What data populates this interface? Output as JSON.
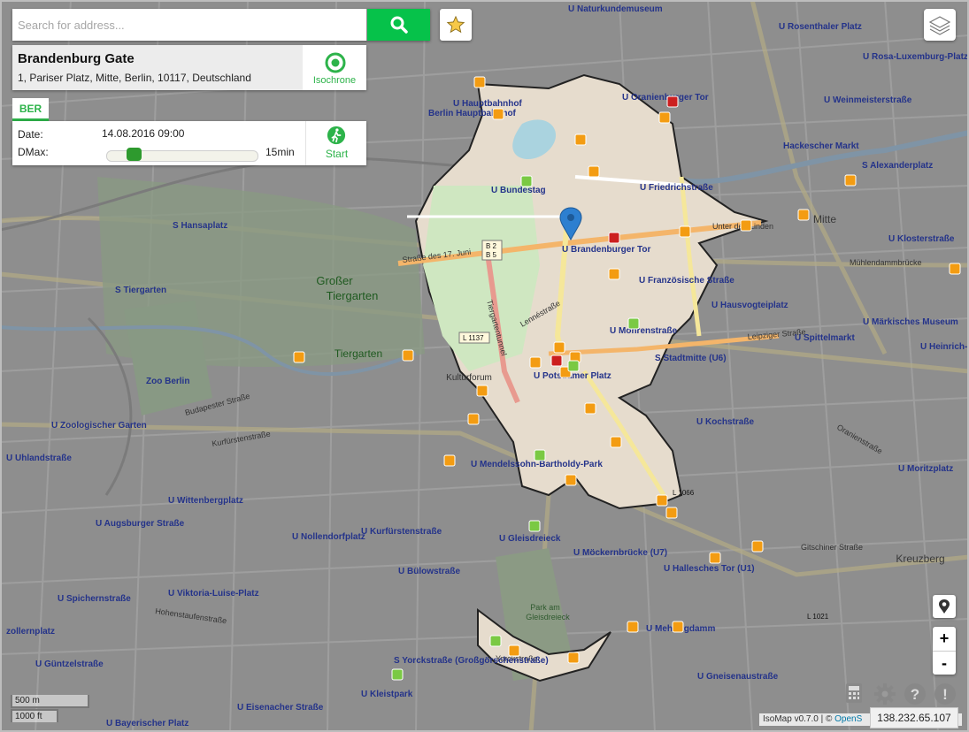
{
  "search": {
    "placeholder": "Search for address..."
  },
  "location": {
    "name": "Brandenburg Gate",
    "address": "1, Pariser Platz, Mitte, Berlin, 10117, Deutschland",
    "isochrone_label": "Isochrone"
  },
  "tab": {
    "label": "BER"
  },
  "form": {
    "date_label": "Date:",
    "date_value": "14.08.2016 09:00",
    "dmax_label": "DMax:",
    "dmax_value": "15min",
    "start_label": "Start"
  },
  "scale": {
    "metric": "500 m",
    "imperial": "1000 ft"
  },
  "attribution": {
    "version": "IsoMap v0.7.0 | ©",
    "osm": "OpenS"
  },
  "ip": "138.232.65.107",
  "colors": {
    "accent": "#2db34a",
    "search_button": "#06c24a",
    "marker": "#2d7fd0"
  },
  "icons": {
    "search": "search-icon",
    "favorite": "star-icon",
    "layers": "layers-icon",
    "isochrone": "target-icon",
    "start": "walker-icon",
    "pin": "location-pin-icon",
    "calculator": "calculator-icon",
    "settings": "gear-icon",
    "help": "question-icon",
    "info": "exclamation-icon"
  },
  "map_labels": {
    "stations": [
      "U Naturkundemuseum",
      "U Rosenthaler Platz",
      "U Rosa-Luxemburg-Platz",
      "U Oranienburger Tor",
      "U Weinmeisterstraße",
      "U Hauptbahnhof",
      "Berlin Hauptbahnhof",
      "Hackescher Markt",
      "S Alexanderplatz",
      "U Bundestag",
      "U Friedrichstraße",
      "S Hansaplatz",
      "U Brandenburger Tor",
      "U Klosterstraße",
      "U Französische Straße",
      "U Hausvogteiplatz",
      "S Tiergarten",
      "U Mohrenstraße",
      "U Märkisches Museum",
      "U Spittelmarkt",
      "S Stadtmitte (U6)",
      "U Potsdamer Platz",
      "U Kochstraße",
      "Zoo Berlin",
      "U Zoologischer Garten",
      "U Mendelssohn-Bartholdy-Park",
      "U Moritzplatz",
      "U Uhlandstraße",
      "U Wittenbergplatz",
      "U Augsburger Straße",
      "U Nollendorfplatz",
      "U Kurfürstenstraße",
      "U Gleisdreieck",
      "U Möckernbrücke (U7)",
      "U Hallesches Tor (U1)",
      "U Bülowstraße",
      "U Viktoria-Luise-Platz",
      "U Spichernstraße",
      "U Mehringdamm",
      "U Güntzelstraße",
      "U Kleistpark",
      "U Eisenacher Straße",
      "U Gneisenaustraße",
      "U Bayerischer Platz",
      "S Yorckstraße (Großgörschenstraße)",
      "U Heinrich-"
    ],
    "areas": [
      "Großer Tiergarten",
      "Tiergarten",
      "Mitte",
      "Kreuzberg",
      "Kulturforum",
      "Park am Gleisdreieck"
    ],
    "streets": [
      "Straße des 17. Juni",
      "Unter den Linden",
      "Leipziger Straße",
      "Lennéstraße",
      "Tiergartentunnel",
      "Budapester Straße",
      "Kurfürstenstraße",
      "Hohenstaufenstraße",
      "Yorckstraße",
      "Gitschiner Straße",
      "Oranienstraße",
      "Mühlendammbrücke"
    ],
    "roads": [
      "B 2",
      "B 5",
      "L 1137",
      "L 1066",
      "L 1021"
    ]
  }
}
